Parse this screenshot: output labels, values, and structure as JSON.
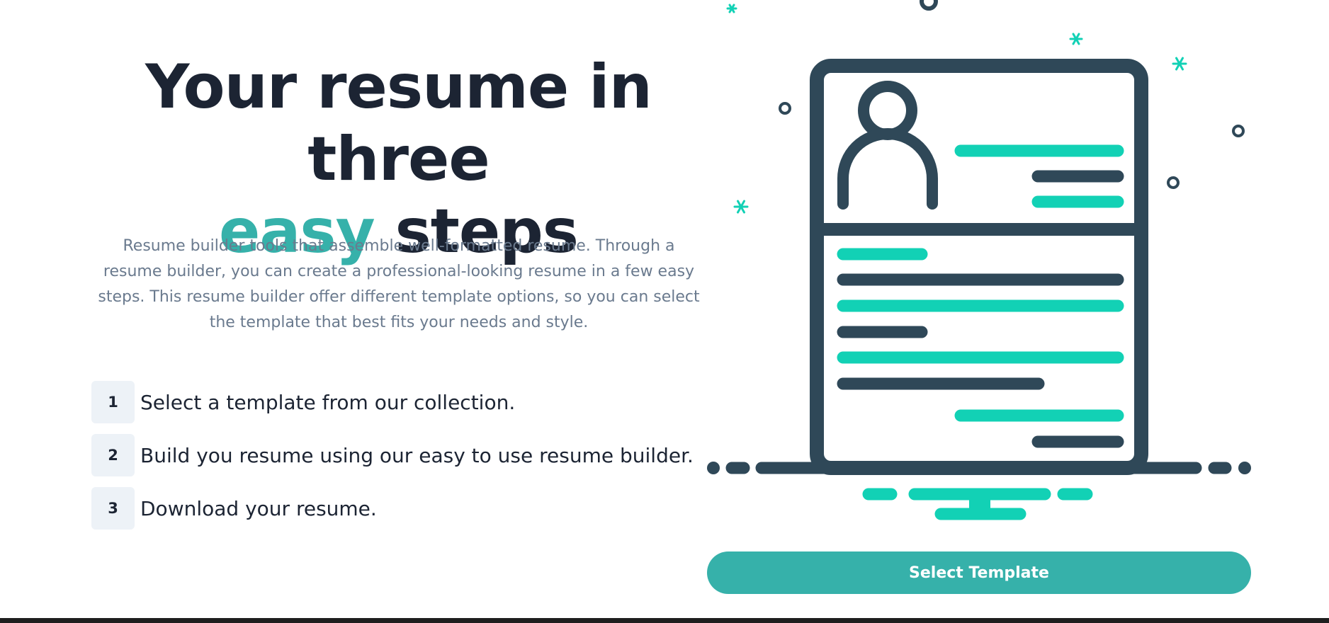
{
  "hero": {
    "title_line1": "Your resume in three",
    "title_accent": "easy",
    "title_rest": "steps",
    "description": "Resume builder tools that assemble well-formatted resume. Through a resume builder, you can create a professional-looking resume in a few easy steps. This resume builder offer different template options, so you can select the template that best fits your needs and style."
  },
  "steps": [
    {
      "number": "1",
      "text": "Select a template from our collection."
    },
    {
      "number": "2",
      "text": "Build you resume using our easy to use resume builder."
    },
    {
      "number": "3",
      "text": "Download your resume."
    }
  ],
  "cta": {
    "label": "Select Template"
  },
  "illustration": {
    "icon": "resume-document-illustration",
    "colors": {
      "dark": "#2f4858",
      "accent": "#12d1b5"
    }
  },
  "colors": {
    "heading": "#1c2433",
    "accent": "#36b1aa",
    "body_text": "#6a7a8e",
    "step_badge_bg": "#edf2f7",
    "button_bg": "#36b1aa",
    "button_text": "#ffffff"
  }
}
